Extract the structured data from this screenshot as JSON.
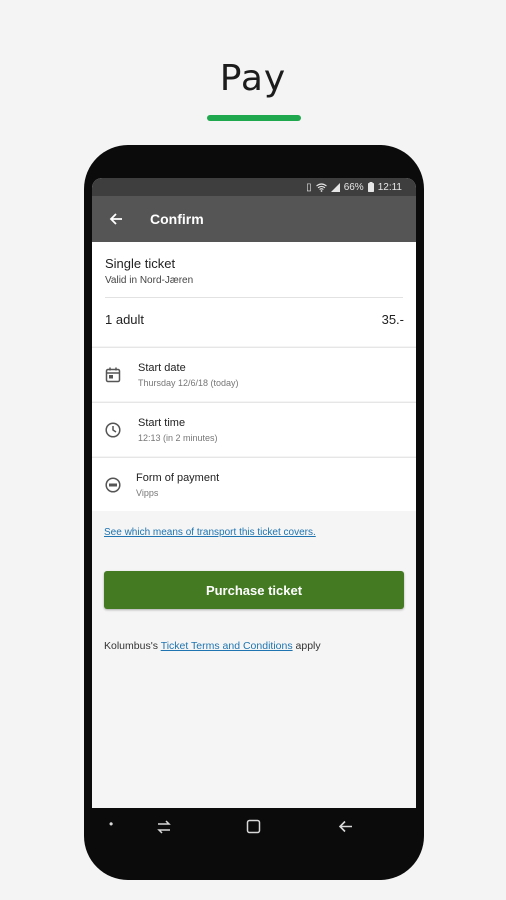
{
  "hero": {
    "title": "Pay"
  },
  "colors": {
    "accent": "#20a84e",
    "appbar": "#555555",
    "primary_button": "#437a22",
    "link": "#1e74b0"
  },
  "statusbar": {
    "battery": "66%",
    "time": "12:11",
    "icons": [
      "vibrate-icon",
      "wifi-icon",
      "signal-icon",
      "battery-icon"
    ]
  },
  "appbar": {
    "back_icon": "arrow-left-icon",
    "title": "Confirm"
  },
  "ticket": {
    "name": "Single ticket",
    "zone": "Valid in Nord-Jæren",
    "passenger": "1 adult",
    "price": "35.-"
  },
  "options": [
    {
      "icon": "calendar-icon",
      "label": "Start date",
      "value": "Thursday 12/6/18 (today)"
    },
    {
      "icon": "clock-icon",
      "label": "Start time",
      "value": "12:13 (in 2 minutes)"
    },
    {
      "icon": "payment-icon",
      "label": "Form of payment",
      "value": "Vipps"
    }
  ],
  "transport_link": "See which means of transport this ticket covers.",
  "purchase_button": "Purchase ticket",
  "terms": {
    "prefix": "Kolumbus's ",
    "link": "Ticket Terms and Conditions",
    "suffix": " apply"
  },
  "navbar": {
    "icons": [
      "dot-icon",
      "recent-apps-icon",
      "home-icon",
      "back-icon"
    ]
  }
}
